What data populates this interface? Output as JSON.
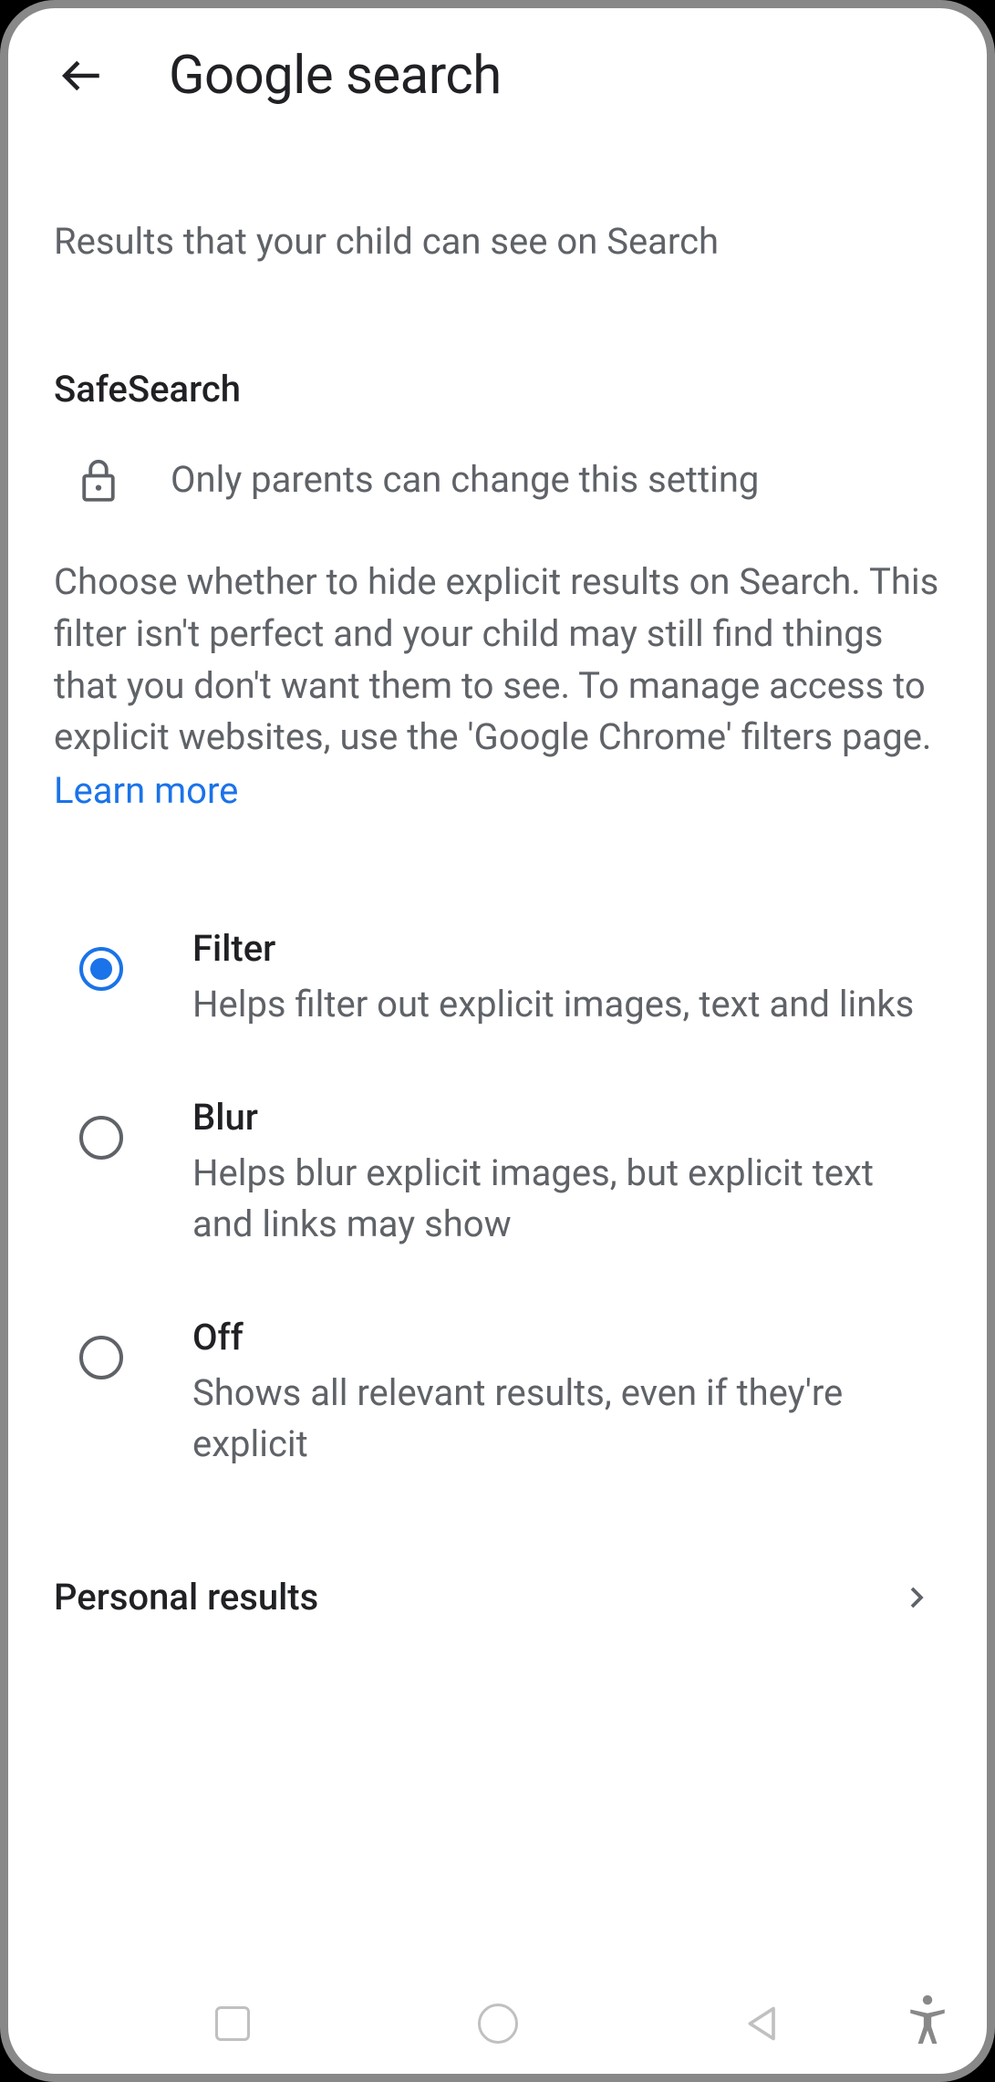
{
  "header": {
    "title": "Google search"
  },
  "subtitle": "Results that your child can see on Search",
  "safesearch": {
    "heading": "SafeSearch",
    "lock_text": "Only parents can change this setting",
    "description": "Choose whether to hide explicit results on Search. This filter isn't perfect and your child may still find things that you don't want them to see. To manage access to explicit websites, use the 'Google Chrome' filters page.",
    "learn_more": "Learn more",
    "options": [
      {
        "title": "Filter",
        "desc": "Helps filter out explicit images, text and links",
        "selected": true
      },
      {
        "title": "Blur",
        "desc": "Helps blur explicit images, but explicit text and links may show",
        "selected": false
      },
      {
        "title": "Off",
        "desc": "Shows all relevant results, even if they're explicit",
        "selected": false
      }
    ]
  },
  "nav_item": {
    "title": "Personal results"
  }
}
